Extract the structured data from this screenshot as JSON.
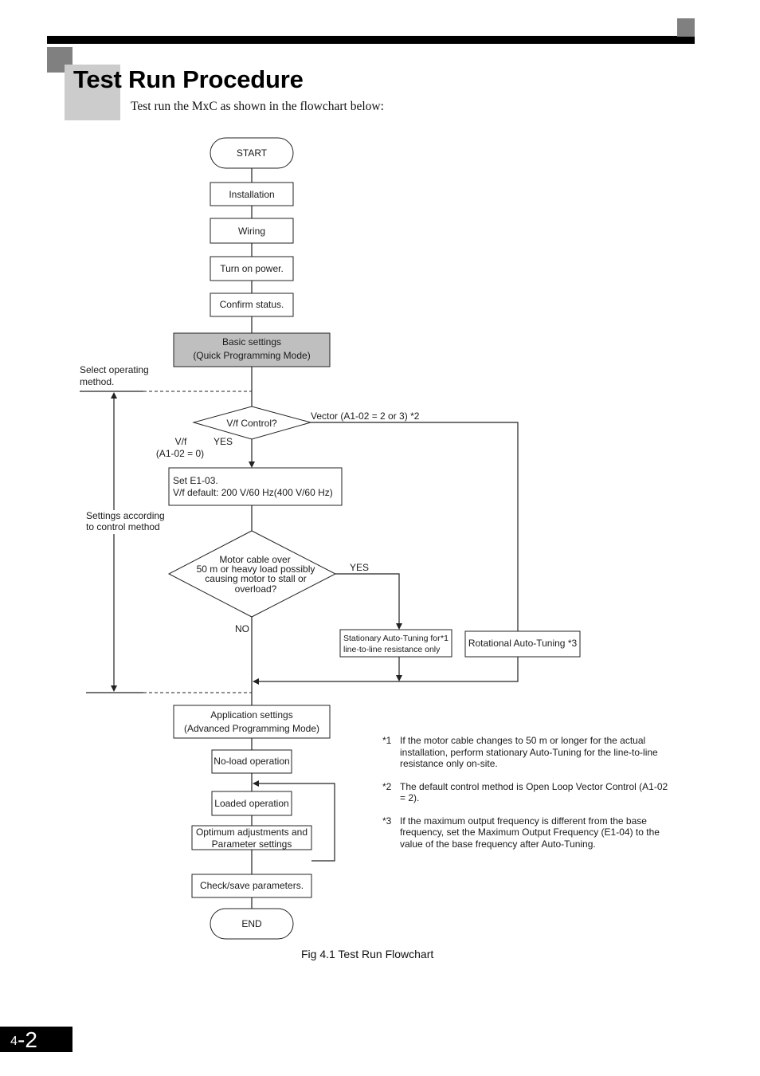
{
  "page": {
    "title": "Test Run Procedure",
    "intro": "Test run the MxC as shown in the flowchart below:",
    "chapter_number": "4",
    "page_suffix": "-2",
    "caption": "Fig 4.1  Test Run Flowchart"
  },
  "flowchart": {
    "start": "START",
    "installation": "Installation",
    "wiring": "Wiring",
    "turn_on_power": "Turn on power.",
    "confirm_status": "Confirm status.",
    "basic_settings": [
      "Basic settings",
      "(Quick Programming Mode)"
    ],
    "select_method_label": [
      "Select operating",
      "method."
    ],
    "vf_decision": "V/f Control?",
    "vector_branch": "Vector (A1-02 = 2 or 3) *2",
    "vf_branch": [
      "V/f",
      "(A1-02 = 0)"
    ],
    "yes_label": "YES",
    "set_e103": [
      "Set E1-03.",
      "V/f default: 200 V/60 Hz(400 V/60 Hz)"
    ],
    "settings_by_method_label": [
      "Settings according",
      "to control method"
    ],
    "motor_decision": [
      "Motor cable over",
      "50 m or heavy load possibly",
      "causing motor to stall or",
      "overload?"
    ],
    "motor_yes": "YES",
    "motor_no": "NO",
    "stationary_tuning": [
      "Stationary Auto-Tuning for",
      "line-to-line resistance only"
    ],
    "stationary_note": "*1",
    "rotational_tuning": "Rotational Auto-Tuning *3",
    "application_settings": [
      "Application settings",
      "(Advanced Programming Mode)"
    ],
    "no_load": "No-load operation",
    "loaded": "Loaded operation",
    "optimum": [
      "Optimum adjustments and",
      "Parameter settings"
    ],
    "check_save": "Check/save parameters.",
    "end": "END"
  },
  "notes": [
    {
      "mark": "*1",
      "text": "If the motor cable changes to 50 m or longer for the actual installation, perform stationary Auto-Tuning for the line-to-line resistance only on-site."
    },
    {
      "mark": "*2",
      "text": "The default control method is Open Loop Vector Control (A1-02 = 2)."
    },
    {
      "mark": "*3",
      "text": "If the maximum output frequency is different from the base frequency, set the Maximum Output Frequency (E1-04) to the value of the base frequency after Auto-Tuning."
    }
  ]
}
